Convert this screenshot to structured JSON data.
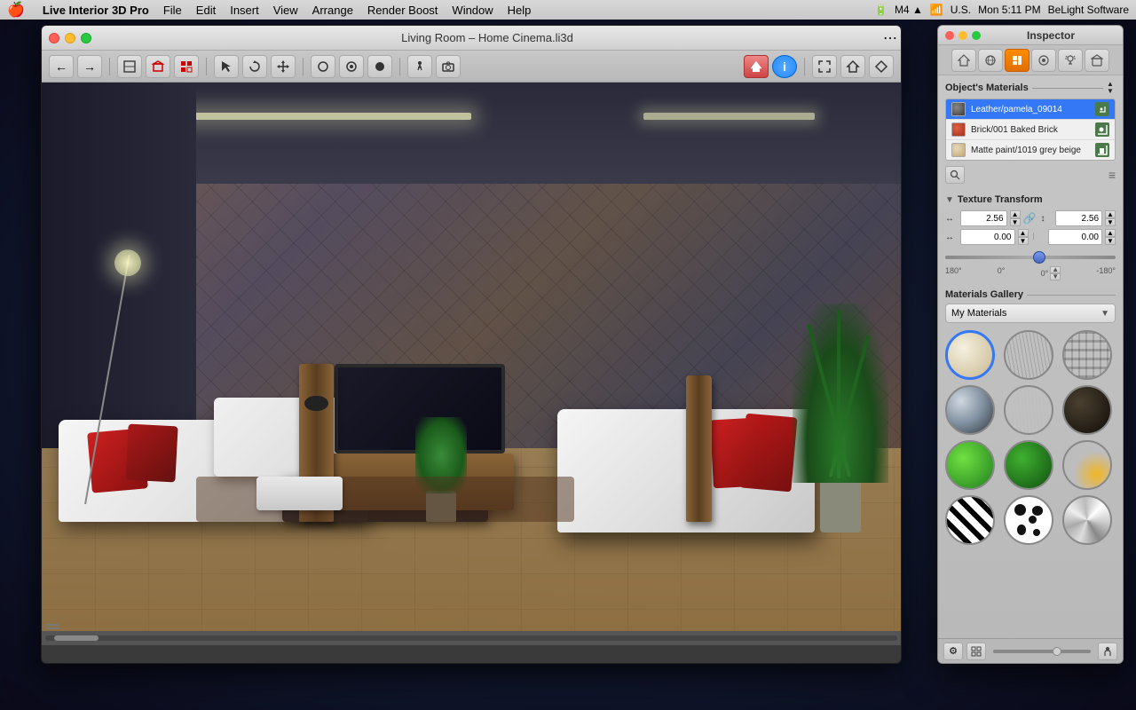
{
  "menubar": {
    "apple": "🍎",
    "app_name": "Live Interior 3D Pro",
    "menus": [
      "File",
      "Edit",
      "Insert",
      "View",
      "Arrange",
      "Render Boost",
      "Window",
      "Help"
    ],
    "right_items": [
      "🔋",
      "M4",
      "📶",
      "U.S.",
      "Mon 5:11 PM",
      "BeLight Software"
    ]
  },
  "window": {
    "title": "Living Room – Home Cinema.li3d",
    "traffic_lights": [
      "close",
      "minimize",
      "maximize"
    ]
  },
  "inspector": {
    "title": "Inspector",
    "tabs": [
      "🏠",
      "🔵",
      "✏️",
      "💿",
      "💡",
      "🏡"
    ],
    "objects_materials_label": "Object's Materials",
    "materials": [
      {
        "name": "Leather/pamela_09014",
        "color": "#5a5a5a",
        "type": "neutral"
      },
      {
        "name": "Brick/001 Baked Brick",
        "color": "#c04030",
        "type": "red"
      },
      {
        "name": "Matte paint/1019 grey beige",
        "color": "#d4c8a8",
        "type": "beige"
      }
    ],
    "texture_transform": {
      "label": "Texture Transform",
      "scale_x": "2.56",
      "scale_y": "2.56",
      "offset_x": "0.00",
      "offset_y": "0.00",
      "angle": "0°",
      "angle_min": "180°",
      "angle_mid": "0°",
      "angle_max": "-180°"
    },
    "gallery": {
      "label": "Materials Gallery",
      "dropdown_value": "My Materials",
      "items": [
        {
          "id": "cream",
          "style": "sphere-cream",
          "selected": true
        },
        {
          "id": "wood-light",
          "style": "sphere-wood-light",
          "selected": false
        },
        {
          "id": "brick",
          "style": "sphere-brick",
          "selected": false
        },
        {
          "id": "metal",
          "style": "sphere-metal",
          "selected": false
        },
        {
          "id": "wood-dark",
          "style": "sphere-wood-dark",
          "selected": false
        },
        {
          "id": "dark",
          "style": "sphere-dark",
          "selected": false
        },
        {
          "id": "green-bright",
          "style": "sphere-green-bright",
          "selected": false
        },
        {
          "id": "green-dark",
          "style": "sphere-green-dark",
          "selected": false
        },
        {
          "id": "fire",
          "style": "sphere-fire",
          "selected": false
        },
        {
          "id": "zebra",
          "style": "sphere-zebra",
          "selected": false
        },
        {
          "id": "dalmatian",
          "style": "sphere-dalmatian",
          "selected": false
        },
        {
          "id": "chrome",
          "style": "sphere-chrome",
          "selected": false
        }
      ]
    }
  },
  "toolbar": {
    "nav_back": "←",
    "nav_fwd": "→",
    "icons": [
      "📐",
      "🏠",
      "📋",
      "↖",
      "⟲",
      "↕",
      "⬤",
      "◎",
      "◉",
      "⚙",
      "📷"
    ]
  }
}
